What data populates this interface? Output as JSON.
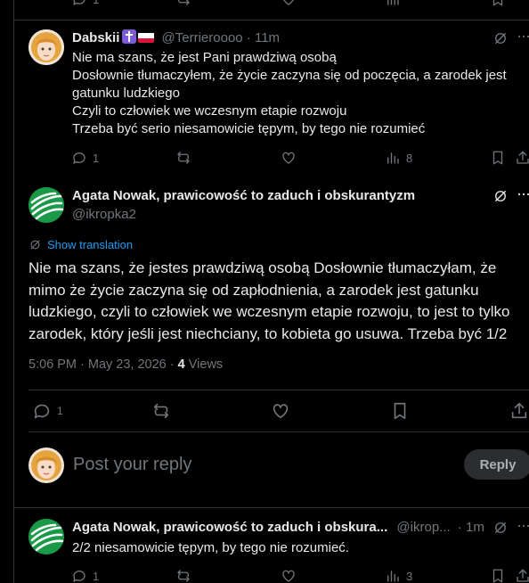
{
  "reply1": {
    "display_name": "Dabskii",
    "handle": "@Terrieroooo",
    "sep": "·",
    "time": "11m",
    "lines": [
      "Nie ma szans, że jest Pani prawdziwą osobą",
      "Dosłownie tłumaczyłem, że życie zaczyna się od poczęcia, a zarodek jest",
      "gatunku ludzkiego",
      "Czyli to człowiek we wczesnym etapie rozwoju",
      "Trzeba być serio niesamowicie tępym, by tego nie rozumieć"
    ],
    "reply_count": "1",
    "views": "8"
  },
  "main_post": {
    "display_name": "Agata Nowak, prawicowość to zaduch i obskurantyzm",
    "handle": "@ikropka2",
    "show_translation": "Show translation",
    "text": "Nie ma szans, że jestes prawdziwą osobą Dosłownie tłumaczyłam, że mimo że życie zaczyna się od zapłodnienia, a zarodek jest gatunku ludzkiego, czyli to człowiek we wczesnym etapie rozwoju, to jest to tylko zarodek, który jeśli jest niechciany, to kobieta go usuwa. Trzeba być 1/2",
    "timestamp": "5:06 PM · May 23, 2026 ·",
    "views_count": "4",
    "views_label": "Views",
    "reply_count": "1"
  },
  "composer": {
    "placeholder": "Post your reply",
    "button": "Reply"
  },
  "reply2": {
    "display_name": "Agata Nowak, prawicowość to zaduch i obskura...",
    "handle": "@ikrop...",
    "sep": "·",
    "time": "1m",
    "text": "2/2 niesamowicie tępym, by tego nie rozumieć.",
    "reply_count": "1",
    "views": "3"
  },
  "top_partial": {
    "reply_count": "1"
  },
  "colors": {
    "link": "#1d9bf0",
    "muted": "#71767b",
    "border": "#2f3336",
    "avatar_green": "#1a9a48"
  }
}
